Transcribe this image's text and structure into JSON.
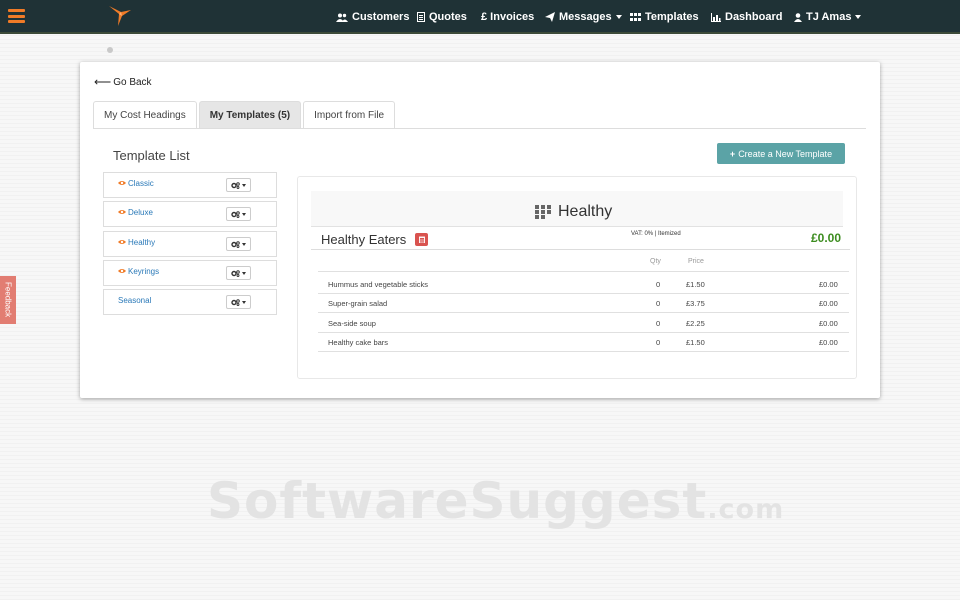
{
  "nav": {
    "items": [
      {
        "label": "Customers",
        "icon": "users-icon"
      },
      {
        "label": "Quotes",
        "icon": "file-icon"
      },
      {
        "label": "£ Invoices",
        "icon": "pound-icon"
      },
      {
        "label": "Messages",
        "icon": "paper-plane-icon"
      },
      {
        "label": "Templates",
        "icon": "templates-icon"
      },
      {
        "label": "Dashboard",
        "icon": "bar-chart-icon"
      },
      {
        "label": "TJ Amas",
        "icon": "user-icon"
      }
    ],
    "accent": "#f07b27",
    "bar_color": "#1f3236"
  },
  "feedback_label": "Feedback",
  "go_back_label": "Go Back",
  "tabs": [
    {
      "label": "My Cost Headings"
    },
    {
      "label": "My Templates (5)"
    },
    {
      "label": "Import from File"
    }
  ],
  "template_list": {
    "title": "Template List",
    "items": [
      {
        "label": "Classic",
        "visible": true
      },
      {
        "label": "Deluxe",
        "visible": true
      },
      {
        "label": "Healthy",
        "visible": true
      },
      {
        "label": "Keyrings",
        "visible": true
      },
      {
        "label": "Seasonal",
        "visible": false
      }
    ]
  },
  "create_button_label": "Create a New Template",
  "preview": {
    "title": "Healthy",
    "section_name": "Healthy Eaters",
    "vat_text": "VAT: 0% | Itemized",
    "section_total": "£0.00",
    "columns": {
      "qty": "Qty",
      "price": "Price"
    },
    "rows": [
      {
        "name": "Hummus and vegetable sticks",
        "qty": "0",
        "price": "£1.50",
        "total": "£0.00"
      },
      {
        "name": "Super-grain salad",
        "qty": "0",
        "price": "£3.75",
        "total": "£0.00"
      },
      {
        "name": "Sea-side soup",
        "qty": "0",
        "price": "£2.25",
        "total": "£0.00"
      },
      {
        "name": "Healthy cake bars",
        "qty": "0",
        "price": "£1.50",
        "total": "£0.00"
      }
    ]
  },
  "watermark": {
    "main": "SoftwareSuggest",
    "suffix": ".com"
  }
}
